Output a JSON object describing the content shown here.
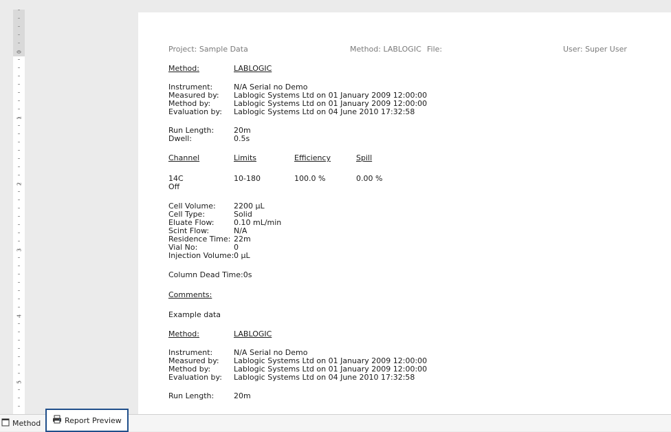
{
  "header": {
    "project": "Project: Sample Data",
    "method": "Method: LABLOGIC",
    "file": "File:",
    "user": "User: Super User"
  },
  "blocks": [
    {
      "method_label": "Method:",
      "method_value": "LABLOGIC",
      "instrument_label": "Instrument:",
      "instrument_value": "N/A Serial no Demo",
      "measured_label": "Measured by:",
      "measured_value": "Lablogic Systems Ltd on 01 January 2009 12:00:00",
      "methodby_label": "Method by:",
      "methodby_value": "Lablogic Systems Ltd on 01 January 2009 12:00:00",
      "evaluation_label": "Evaluation by:",
      "evaluation_value": "Lablogic Systems Ltd on 04 June 2010 17:32:58",
      "runlength_label": "Run Length:",
      "runlength_value": "20m",
      "dwell_label": "Dwell:",
      "dwell_value": "0.5s"
    },
    {
      "method_label": "Method:",
      "method_value": "LABLOGIC",
      "instrument_label": "Instrument:",
      "instrument_value": "N/A Serial no Demo",
      "measured_label": "Measured by:",
      "measured_value": "Lablogic Systems Ltd on 01 January 2009 12:00:00",
      "methodby_label": "Method by:",
      "methodby_value": "Lablogic Systems Ltd on 01 January 2009 12:00:00",
      "evaluation_label": "Evaluation by:",
      "evaluation_value": "Lablogic Systems Ltd on 04 June 2010 17:32:58",
      "runlength_label": "Run Length:",
      "runlength_value": "20m"
    }
  ],
  "channel_table": {
    "headers": [
      "Channel",
      "Limits",
      "Efficiency",
      "Spill"
    ],
    "row": [
      "14C",
      "10-180",
      "100.0 %",
      "0.00 %"
    ],
    "row2": "Off"
  },
  "cell": {
    "volume_label": "Cell Volume:",
    "volume_value": "2200 µL",
    "type_label": "Cell Type:",
    "type_value": "Solid",
    "eluate_label": "Eluate Flow:",
    "eluate_value": "0.10 mL/min",
    "scint_label": "Scint Flow:",
    "scint_value": "N/A",
    "residence_label": "Residence Time:",
    "residence_value": "22m",
    "vial_label": "Vial No:",
    "vial_value": "0",
    "injection_label": "Injection Volume:",
    "injection_value": "0 µL",
    "dead_time": "Column Dead Time:0s"
  },
  "comments": {
    "label": "Comments:",
    "text": "Example data"
  },
  "ruler": {
    "numbers": [
      "0",
      "1",
      "2",
      "3",
      "4",
      "5"
    ]
  },
  "tabs": {
    "method": "Method",
    "report_preview": "Report Preview"
  }
}
